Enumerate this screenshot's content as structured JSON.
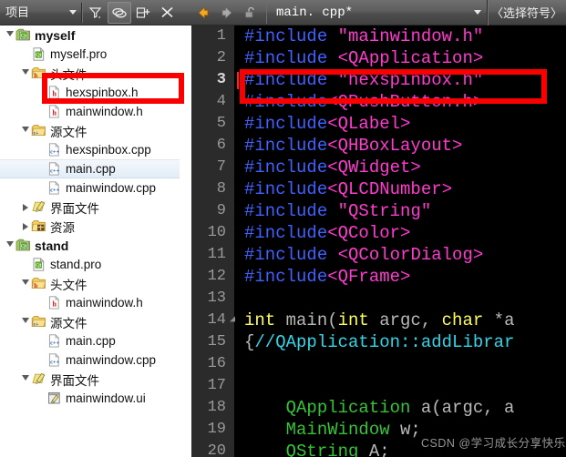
{
  "left_toolbar": {
    "combo_label": "项目",
    "buttons": [
      {
        "name": "filter-icon",
        "tooltip": "筛选"
      },
      {
        "name": "link-icon",
        "tooltip": "与编辑器同步"
      },
      {
        "name": "split-add-icon",
        "tooltip": "添加拆分"
      },
      {
        "name": "close-icon",
        "tooltip": "关闭"
      }
    ]
  },
  "right_toolbar": {
    "back_label": "后退",
    "forward_label": "前进",
    "lock_label": "锁定",
    "filename": "main. cpp*",
    "symbol_selector": "〈选择符号〉"
  },
  "tree": {
    "items": [
      {
        "indent": 0,
        "arrow": "open",
        "icon": "qt-project-icon",
        "label": "myself",
        "bold": true,
        "selected": false
      },
      {
        "indent": 1,
        "arrow": "none",
        "icon": "qt-pro-file-icon",
        "label": "myself.pro",
        "bold": false,
        "selected": false
      },
      {
        "indent": 1,
        "arrow": "open",
        "icon": "folder-h-icon",
        "label": "头文件",
        "bold": false,
        "selected": false
      },
      {
        "indent": 2,
        "arrow": "none",
        "icon": "h-file-icon",
        "label": "hexspinbox.h",
        "bold": false,
        "selected": false
      },
      {
        "indent": 2,
        "arrow": "none",
        "icon": "h-file-icon",
        "label": "mainwindow.h",
        "bold": false,
        "selected": false
      },
      {
        "indent": 1,
        "arrow": "open",
        "icon": "folder-cpp-icon",
        "label": "源文件",
        "bold": false,
        "selected": false
      },
      {
        "indent": 2,
        "arrow": "none",
        "icon": "cpp-file-icon",
        "label": "hexspinbox.cpp",
        "bold": false,
        "selected": false
      },
      {
        "indent": 2,
        "arrow": "none",
        "icon": "cpp-file-icon",
        "label": "main.cpp",
        "bold": false,
        "selected": true
      },
      {
        "indent": 2,
        "arrow": "none",
        "icon": "cpp-file-icon",
        "label": "mainwindow.cpp",
        "bold": false,
        "selected": false
      },
      {
        "indent": 1,
        "arrow": "closed",
        "icon": "folder-ui-icon",
        "label": "界面文件",
        "bold": false,
        "selected": false
      },
      {
        "indent": 1,
        "arrow": "closed",
        "icon": "folder-res-icon",
        "label": "资源",
        "bold": false,
        "selected": false
      },
      {
        "indent": 0,
        "arrow": "open",
        "icon": "qt-project-icon",
        "label": "stand",
        "bold": true,
        "selected": false
      },
      {
        "indent": 1,
        "arrow": "none",
        "icon": "qt-pro-file-icon",
        "label": "stand.pro",
        "bold": false,
        "selected": false
      },
      {
        "indent": 1,
        "arrow": "open",
        "icon": "folder-h-icon",
        "label": "头文件",
        "bold": false,
        "selected": false
      },
      {
        "indent": 2,
        "arrow": "none",
        "icon": "h-file-icon",
        "label": "mainwindow.h",
        "bold": false,
        "selected": false
      },
      {
        "indent": 1,
        "arrow": "open",
        "icon": "folder-cpp-icon",
        "label": "源文件",
        "bold": false,
        "selected": false
      },
      {
        "indent": 2,
        "arrow": "none",
        "icon": "cpp-file-icon",
        "label": "main.cpp",
        "bold": false,
        "selected": false
      },
      {
        "indent": 2,
        "arrow": "none",
        "icon": "cpp-file-icon",
        "label": "mainwindow.cpp",
        "bold": false,
        "selected": false
      },
      {
        "indent": 1,
        "arrow": "open",
        "icon": "folder-ui-icon",
        "label": "界面文件",
        "bold": false,
        "selected": false
      },
      {
        "indent": 2,
        "arrow": "none",
        "icon": "ui-file-icon",
        "label": "mainwindow.ui",
        "bold": false,
        "selected": false
      }
    ]
  },
  "editor": {
    "cursor_line": 3,
    "fold_lines": [
      14
    ],
    "lines": [
      {
        "n": "1",
        "tokens": [
          {
            "t": "#include ",
            "c": "k-pre"
          },
          {
            "t": "\"mainwindow.h\"",
            "c": "k-str"
          }
        ]
      },
      {
        "n": "2",
        "tokens": [
          {
            "t": "#include ",
            "c": "k-pre"
          },
          {
            "t": "<QApplication>",
            "c": "k-str"
          }
        ]
      },
      {
        "n": "3",
        "tokens": [
          {
            "t": "#include ",
            "c": "k-pre"
          },
          {
            "t": "\"hexspinbox.h\"",
            "c": "k-str"
          }
        ]
      },
      {
        "n": "4",
        "tokens": [
          {
            "t": "#include",
            "c": "k-pre"
          },
          {
            "t": "<QPushButton.h>",
            "c": "k-str"
          }
        ]
      },
      {
        "n": "5",
        "tokens": [
          {
            "t": "#include",
            "c": "k-pre"
          },
          {
            "t": "<QLabel>",
            "c": "k-str"
          }
        ]
      },
      {
        "n": "6",
        "tokens": [
          {
            "t": "#include",
            "c": "k-pre"
          },
          {
            "t": "<QHBoxLayout>",
            "c": "k-str"
          }
        ]
      },
      {
        "n": "7",
        "tokens": [
          {
            "t": "#include",
            "c": "k-pre"
          },
          {
            "t": "<QWidget>",
            "c": "k-str"
          }
        ]
      },
      {
        "n": "8",
        "tokens": [
          {
            "t": "#include",
            "c": "k-pre"
          },
          {
            "t": "<QLCDNumber>",
            "c": "k-str"
          }
        ]
      },
      {
        "n": "9",
        "tokens": [
          {
            "t": "#include ",
            "c": "k-pre"
          },
          {
            "t": "\"QString\"",
            "c": "k-str"
          }
        ]
      },
      {
        "n": "10",
        "tokens": [
          {
            "t": "#include",
            "c": "k-pre"
          },
          {
            "t": "<QColor>",
            "c": "k-str"
          }
        ]
      },
      {
        "n": "11",
        "tokens": [
          {
            "t": "#include ",
            "c": "k-pre"
          },
          {
            "t": "<QColorDialog>",
            "c": "k-str"
          }
        ]
      },
      {
        "n": "12",
        "tokens": [
          {
            "t": "#include",
            "c": "k-pre"
          },
          {
            "t": "<QFrame>",
            "c": "k-str"
          }
        ]
      },
      {
        "n": "13",
        "tokens": []
      },
      {
        "n": "14",
        "tokens": [
          {
            "t": "int ",
            "c": "k-type"
          },
          {
            "t": "main(",
            "c": "k-grey"
          },
          {
            "t": "int ",
            "c": "k-type"
          },
          {
            "t": "argc, ",
            "c": "k-grey"
          },
          {
            "t": "char ",
            "c": "k-type"
          },
          {
            "t": "*a",
            "c": "k-grey"
          }
        ]
      },
      {
        "n": "15",
        "tokens": [
          {
            "t": "{",
            "c": "k-grey"
          },
          {
            "t": "//QApplication::addLibrar",
            "c": "k-cmt"
          }
        ]
      },
      {
        "n": "16",
        "tokens": []
      },
      {
        "n": "17",
        "tokens": []
      },
      {
        "n": "18",
        "tokens": [
          {
            "t": "    ",
            "c": "k-plain"
          },
          {
            "t": "QApplication ",
            "c": "k-green"
          },
          {
            "t": "a(argc, a",
            "c": "k-grey"
          }
        ]
      },
      {
        "n": "19",
        "tokens": [
          {
            "t": "    ",
            "c": "k-plain"
          },
          {
            "t": "MainWindow ",
            "c": "k-green"
          },
          {
            "t": "w;",
            "c": "k-grey"
          }
        ]
      },
      {
        "n": "20",
        "tokens": [
          {
            "t": "    ",
            "c": "k-plain"
          },
          {
            "t": "QString ",
            "c": "k-green"
          },
          {
            "t": "A;",
            "c": "k-grey"
          }
        ]
      }
    ]
  },
  "annotations": {
    "tree_highlight_target": "hexspinbox.h",
    "code_highlight_target": "#include \"hexspinbox.h\"",
    "box_color": "#fb0000"
  },
  "watermark": {
    "text": "CSDN @学习成长分享快乐"
  }
}
